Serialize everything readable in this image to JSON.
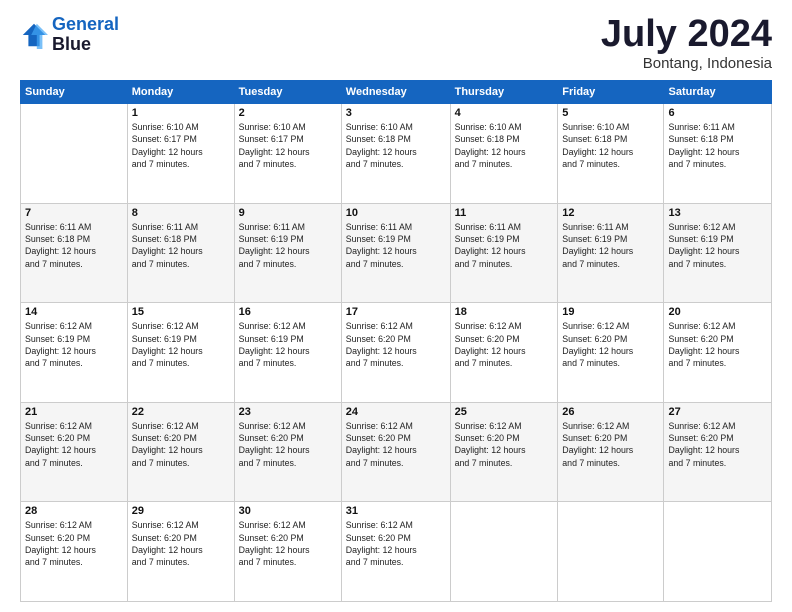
{
  "logo": {
    "line1": "General",
    "line2": "Blue"
  },
  "title": "July 2024",
  "subtitle": "Bontang, Indonesia",
  "days_of_week": [
    "Sunday",
    "Monday",
    "Tuesday",
    "Wednesday",
    "Thursday",
    "Friday",
    "Saturday"
  ],
  "weeks": [
    [
      {
        "day": "",
        "info": ""
      },
      {
        "day": "1",
        "info": "Sunrise: 6:10 AM\nSunset: 6:17 PM\nDaylight: 12 hours\nand 7 minutes."
      },
      {
        "day": "2",
        "info": "Sunrise: 6:10 AM\nSunset: 6:17 PM\nDaylight: 12 hours\nand 7 minutes."
      },
      {
        "day": "3",
        "info": "Sunrise: 6:10 AM\nSunset: 6:18 PM\nDaylight: 12 hours\nand 7 minutes."
      },
      {
        "day": "4",
        "info": "Sunrise: 6:10 AM\nSunset: 6:18 PM\nDaylight: 12 hours\nand 7 minutes."
      },
      {
        "day": "5",
        "info": "Sunrise: 6:10 AM\nSunset: 6:18 PM\nDaylight: 12 hours\nand 7 minutes."
      },
      {
        "day": "6",
        "info": "Sunrise: 6:11 AM\nSunset: 6:18 PM\nDaylight: 12 hours\nand 7 minutes."
      }
    ],
    [
      {
        "day": "7",
        "info": "Sunrise: 6:11 AM\nSunset: 6:18 PM\nDaylight: 12 hours\nand 7 minutes."
      },
      {
        "day": "8",
        "info": "Sunrise: 6:11 AM\nSunset: 6:18 PM\nDaylight: 12 hours\nand 7 minutes."
      },
      {
        "day": "9",
        "info": "Sunrise: 6:11 AM\nSunset: 6:19 PM\nDaylight: 12 hours\nand 7 minutes."
      },
      {
        "day": "10",
        "info": "Sunrise: 6:11 AM\nSunset: 6:19 PM\nDaylight: 12 hours\nand 7 minutes."
      },
      {
        "day": "11",
        "info": "Sunrise: 6:11 AM\nSunset: 6:19 PM\nDaylight: 12 hours\nand 7 minutes."
      },
      {
        "day": "12",
        "info": "Sunrise: 6:11 AM\nSunset: 6:19 PM\nDaylight: 12 hours\nand 7 minutes."
      },
      {
        "day": "13",
        "info": "Sunrise: 6:12 AM\nSunset: 6:19 PM\nDaylight: 12 hours\nand 7 minutes."
      }
    ],
    [
      {
        "day": "14",
        "info": "Sunrise: 6:12 AM\nSunset: 6:19 PM\nDaylight: 12 hours\nand 7 minutes."
      },
      {
        "day": "15",
        "info": "Sunrise: 6:12 AM\nSunset: 6:19 PM\nDaylight: 12 hours\nand 7 minutes."
      },
      {
        "day": "16",
        "info": "Sunrise: 6:12 AM\nSunset: 6:19 PM\nDaylight: 12 hours\nand 7 minutes."
      },
      {
        "day": "17",
        "info": "Sunrise: 6:12 AM\nSunset: 6:20 PM\nDaylight: 12 hours\nand 7 minutes."
      },
      {
        "day": "18",
        "info": "Sunrise: 6:12 AM\nSunset: 6:20 PM\nDaylight: 12 hours\nand 7 minutes."
      },
      {
        "day": "19",
        "info": "Sunrise: 6:12 AM\nSunset: 6:20 PM\nDaylight: 12 hours\nand 7 minutes."
      },
      {
        "day": "20",
        "info": "Sunrise: 6:12 AM\nSunset: 6:20 PM\nDaylight: 12 hours\nand 7 minutes."
      }
    ],
    [
      {
        "day": "21",
        "info": "Sunrise: 6:12 AM\nSunset: 6:20 PM\nDaylight: 12 hours\nand 7 minutes."
      },
      {
        "day": "22",
        "info": "Sunrise: 6:12 AM\nSunset: 6:20 PM\nDaylight: 12 hours\nand 7 minutes."
      },
      {
        "day": "23",
        "info": "Sunrise: 6:12 AM\nSunset: 6:20 PM\nDaylight: 12 hours\nand 7 minutes."
      },
      {
        "day": "24",
        "info": "Sunrise: 6:12 AM\nSunset: 6:20 PM\nDaylight: 12 hours\nand 7 minutes."
      },
      {
        "day": "25",
        "info": "Sunrise: 6:12 AM\nSunset: 6:20 PM\nDaylight: 12 hours\nand 7 minutes."
      },
      {
        "day": "26",
        "info": "Sunrise: 6:12 AM\nSunset: 6:20 PM\nDaylight: 12 hours\nand 7 minutes."
      },
      {
        "day": "27",
        "info": "Sunrise: 6:12 AM\nSunset: 6:20 PM\nDaylight: 12 hours\nand 7 minutes."
      }
    ],
    [
      {
        "day": "28",
        "info": "Sunrise: 6:12 AM\nSunset: 6:20 PM\nDaylight: 12 hours\nand 7 minutes."
      },
      {
        "day": "29",
        "info": "Sunrise: 6:12 AM\nSunset: 6:20 PM\nDaylight: 12 hours\nand 7 minutes."
      },
      {
        "day": "30",
        "info": "Sunrise: 6:12 AM\nSunset: 6:20 PM\nDaylight: 12 hours\nand 7 minutes."
      },
      {
        "day": "31",
        "info": "Sunrise: 6:12 AM\nSunset: 6:20 PM\nDaylight: 12 hours\nand 7 minutes."
      },
      {
        "day": "",
        "info": ""
      },
      {
        "day": "",
        "info": ""
      },
      {
        "day": "",
        "info": ""
      }
    ]
  ]
}
